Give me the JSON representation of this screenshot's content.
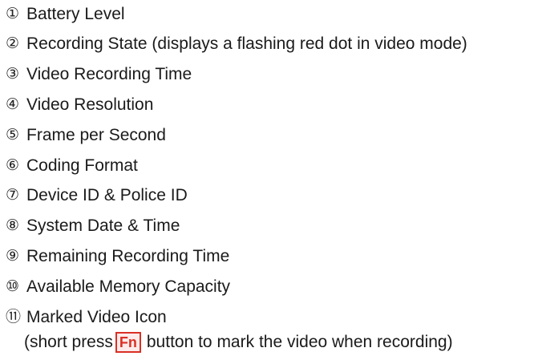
{
  "items": [
    {
      "number": "①",
      "label": "Battery Level"
    },
    {
      "number": "②",
      "label": "Recording State (displays a flashing red dot in video mode)"
    },
    {
      "number": "③",
      "label": "Video Recording Time"
    },
    {
      "number": "④",
      "label": "Video Resolution"
    },
    {
      "number": "⑤",
      "label": "Frame per Second"
    },
    {
      "number": "⑥",
      "label": "Coding Format"
    },
    {
      "number": "⑦",
      "label": "Device ID & Police ID"
    },
    {
      "number": "⑧",
      "label": "System Date & Time"
    },
    {
      "number": "⑨",
      "label": "Remaining Recording Time"
    },
    {
      "number": "⑩",
      "label": "Available Memory Capacity"
    },
    {
      "number": "⑪",
      "label": "Marked Video Icon"
    }
  ],
  "note": {
    "prefix": "(short press",
    "key_label": "Fn",
    "suffix": "button to mark the video when recording)"
  },
  "colors": {
    "text": "#1a1a1a",
    "fn_key_accent": "#d93025",
    "fn_key_fill": "#fdeaea"
  }
}
